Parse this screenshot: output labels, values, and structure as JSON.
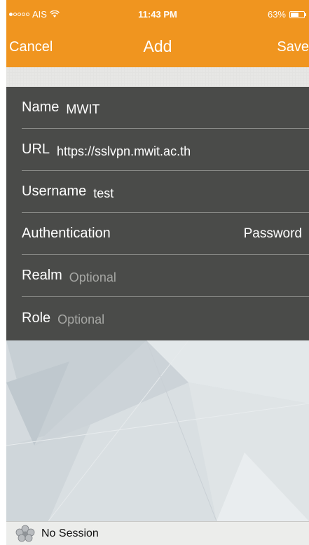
{
  "status_bar": {
    "carrier": "AIS",
    "time": "11:43 PM",
    "battery": "63%",
    "battery_level": 0.63
  },
  "nav": {
    "cancel_label": "Cancel",
    "title": "Add",
    "save_label": "Save"
  },
  "form": {
    "name": {
      "label": "Name",
      "value": "MWIT"
    },
    "url": {
      "label": "URL",
      "value": "https://sslvpn.mwit.ac.th"
    },
    "username": {
      "label": "Username",
      "value": "test"
    },
    "authentication": {
      "label": "Authentication",
      "value": "Password"
    },
    "realm": {
      "label": "Realm",
      "placeholder": "Optional"
    },
    "role": {
      "label": "Role",
      "placeholder": "Optional"
    }
  },
  "footer": {
    "status": "No Session"
  },
  "colors": {
    "accent": "#f0951f",
    "form_bg": "#4a4b49"
  }
}
